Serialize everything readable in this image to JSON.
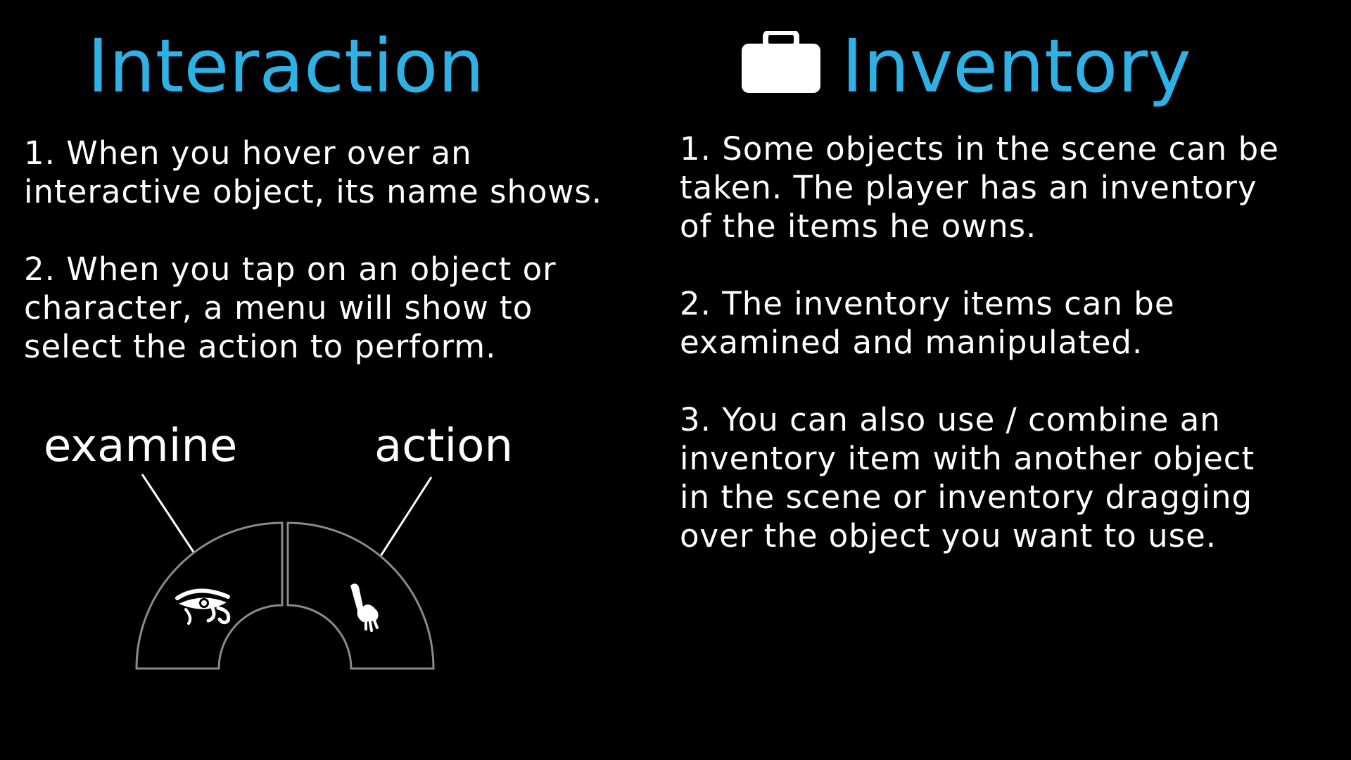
{
  "interaction": {
    "title": "Interaction",
    "para1": [
      "1. When you hover over an",
      "interactive object, its name shows."
    ],
    "para2": [
      "2. When you tap on an object or",
      "character, a menu will show to",
      "select the action to perform."
    ]
  },
  "menu": {
    "examine_label": "examine",
    "action_label": "action",
    "examine_icon": "eye-of-horus-icon",
    "action_icon": "hand-icon"
  },
  "inventory": {
    "title": "Inventory",
    "title_icon": "suitcase-icon",
    "para1": [
      "1. Some objects in the scene can be",
      "taken. The player has an inventory",
      "of the items he owns."
    ],
    "para2": [
      "2. The inventory items can be",
      "examined and manipulated."
    ],
    "para3": [
      "3. You can also use / combine an",
      "inventory item with another object",
      "in the scene or inventory dragging",
      "over the object you want to use."
    ]
  },
  "colors": {
    "background": "#000000",
    "title": "#2fb1e6",
    "text": "#ffffff",
    "menu_outline": "#8a8a8a"
  }
}
